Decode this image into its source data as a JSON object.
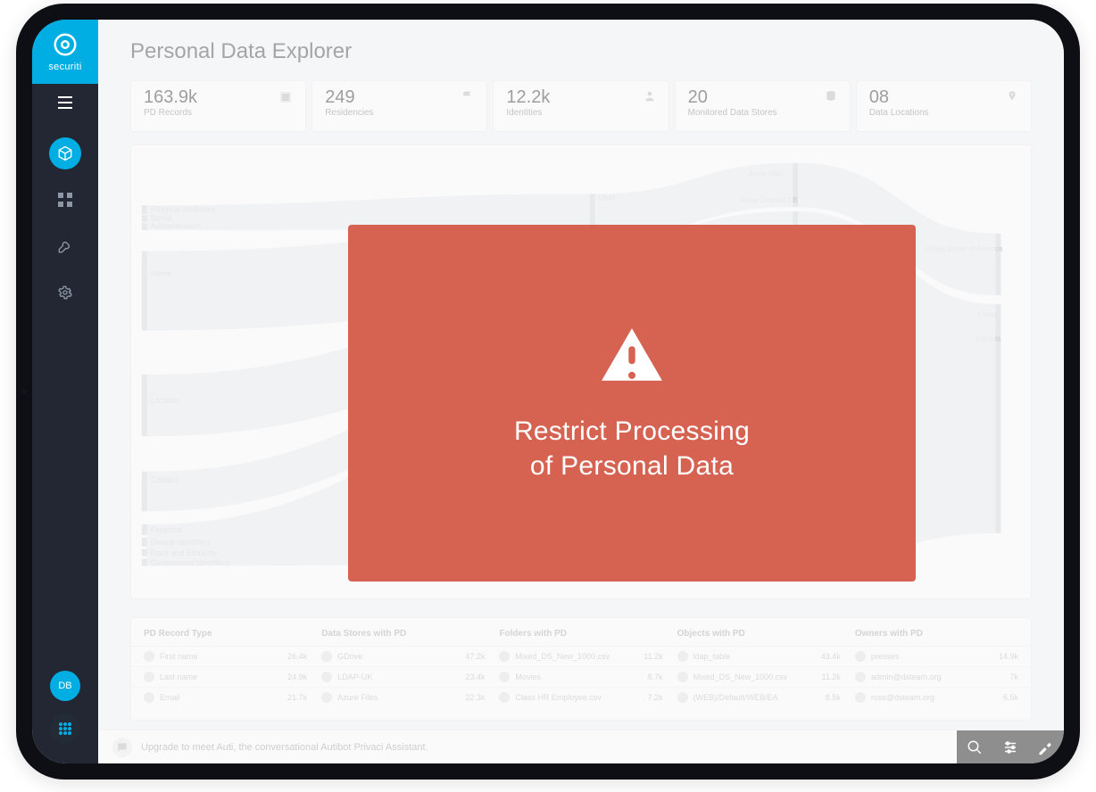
{
  "brand": "securiti",
  "page_title": "Personal Data Explorer",
  "sidebar": {
    "user_initials": "DB"
  },
  "stats": [
    {
      "value": "163.9k",
      "label": "PD Records"
    },
    {
      "value": "249",
      "label": "Residencies"
    },
    {
      "value": "12.2k",
      "label": "Identities"
    },
    {
      "value": "20",
      "label": "Monitored Data Stores"
    },
    {
      "value": "08",
      "label": "Data Locations"
    }
  ],
  "sankey": {
    "left_categories": [
      "Physical attributes",
      "Social",
      "Authentication",
      "Name",
      "Location",
      "Contact",
      "Financial",
      "Device identifiers",
      "Race and Ethnicity",
      "Government identifiers"
    ],
    "mid_label": "User",
    "right_top": [
      "Azure Files",
      "Azure Cosmos DB"
    ],
    "far_right": [
      "United States of America",
      "China",
      "Canada"
    ]
  },
  "table": {
    "headers": [
      "PD Record Type",
      "Data Stores with PD",
      "Folders with PD",
      "Objects with PD",
      "Owners with PD"
    ],
    "rows": [
      {
        "c0": {
          "label": "First name",
          "val": "26.4k"
        },
        "c1": {
          "label": "GDrive",
          "val": "47.2k"
        },
        "c2": {
          "label": "Mixed_DS_New_1000.csv",
          "val": "11.2k"
        },
        "c3": {
          "label": "ldap_table",
          "val": "43.4k"
        },
        "c4": {
          "label": "presses",
          "val": "14.9k"
        }
      },
      {
        "c0": {
          "label": "Last name",
          "val": "24.9k"
        },
        "c1": {
          "label": "LDAP-UK",
          "val": "23.4k"
        },
        "c2": {
          "label": "Movies",
          "val": "8.7k"
        },
        "c3": {
          "label": "Mixed_DS_New_1000.csv",
          "val": "11.2k"
        },
        "c4": {
          "label": "admin@dsteam.org",
          "val": "7k"
        }
      },
      {
        "c0": {
          "label": "Email",
          "val": "21.7k"
        },
        "c1": {
          "label": "Azure Files",
          "val": "22.3k"
        },
        "c2": {
          "label": "Class HR Employee.csv",
          "val": "7.2k"
        },
        "c3": {
          "label": "(WEB)/Default/WEB/EA",
          "val": "8.5k"
        },
        "c4": {
          "label": "ross@dsteam.org",
          "val": "6.5k"
        }
      }
    ]
  },
  "assistant": {
    "message": "Upgrade to meet Auti, the conversational Autibot Privaci Assistant."
  },
  "modal": {
    "line1": "Restrict Processing",
    "line2": "of Personal Data"
  }
}
